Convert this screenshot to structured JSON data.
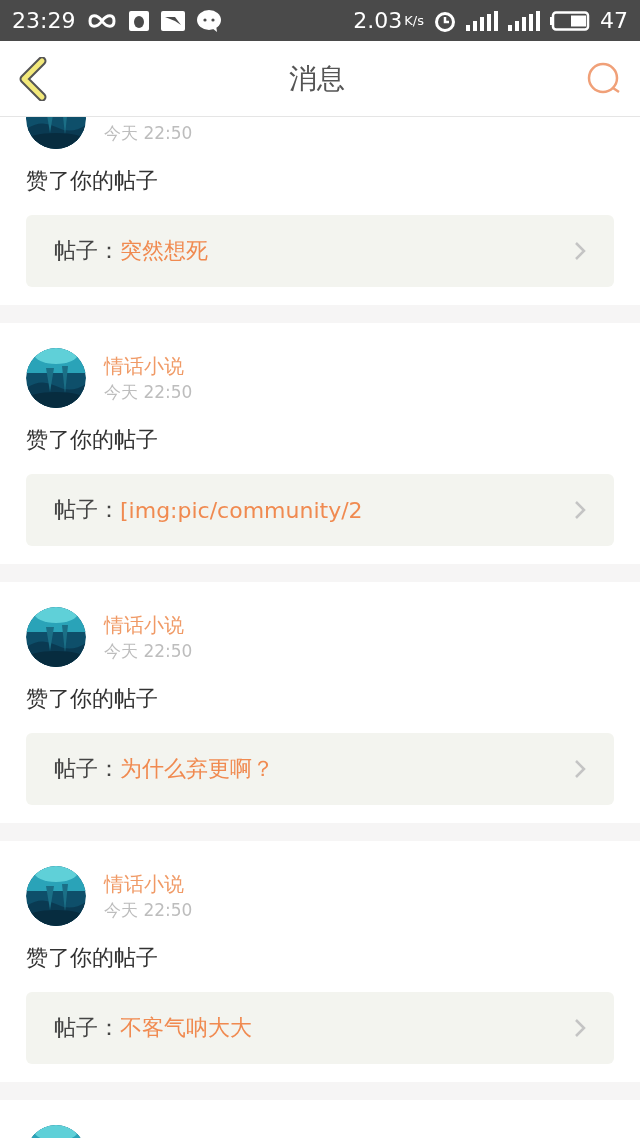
{
  "status_bar": {
    "time": "23:29",
    "speed": "2.03",
    "speed_unit": "K/s",
    "battery": "47"
  },
  "header": {
    "title": "消息"
  },
  "messages": [
    {
      "avatar": {
        "kind": "picture"
      },
      "time": "今天 22:50",
      "action": "赞了你的帖子",
      "post_label": "帖子：",
      "post_title": "突然想死"
    },
    {
      "avatar": {
        "kind": "picture"
      },
      "name": "情话小说",
      "time": "今天 22:50",
      "action": "赞了你的帖子",
      "post_label": "帖子：",
      "post_title": "[img:pic/community/2"
    },
    {
      "avatar": {
        "kind": "picture"
      },
      "name": "情话小说",
      "time": "今天 22:50",
      "action": "赞了你的帖子",
      "post_label": "帖子：",
      "post_title": "为什么弃更啊？"
    },
    {
      "avatar": {
        "kind": "picture"
      },
      "name": "情话小说",
      "time": "今天 22:50",
      "action": "赞了你的帖子",
      "post_label": "帖子：",
      "post_title": "不客气呐大大"
    },
    {
      "avatar": {
        "kind": "picture"
      }
    }
  ]
}
